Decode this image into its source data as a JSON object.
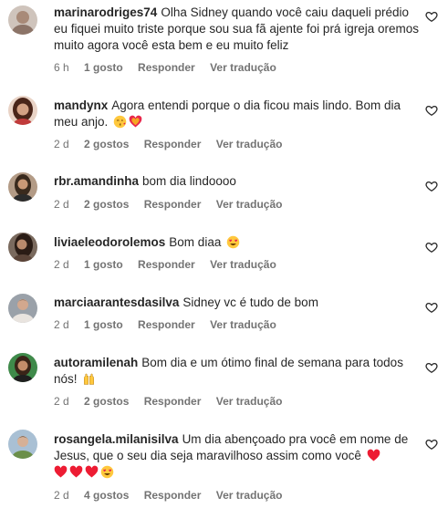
{
  "comments": [
    {
      "username": "marinarodriges74",
      "text": "Olha Sidney quando você caiu daqueli prédio eu fiquei muito triste porque sou sua fã ajente foi prá igreja oremos muito agora você esta bem e eu muito feliz",
      "time": "6 h",
      "likes": "1 gosto",
      "reply": "Responder",
      "translate": "Ver tradução",
      "avatar_color": "#b9a89e"
    },
    {
      "username": "mandynx",
      "text": "Agora entendi porque o dia ficou mais lindo. Bom dia meu anjo.",
      "emojis": [
        "kiss-emoji",
        "heart-emoji"
      ],
      "time": "2 d",
      "likes": "2 gostos",
      "reply": "Responder",
      "translate": "Ver tradução",
      "avatar_color": "#6b3a2a"
    },
    {
      "username": "rbr.amandinha",
      "text": "bom dia lindoooo",
      "time": "2 d",
      "likes": "2 gostos",
      "reply": "Responder",
      "translate": "Ver tradução",
      "avatar_color": "#4a3a2c"
    },
    {
      "username": "liviaeleodorolemos",
      "text": "Bom diaa",
      "emojis": [
        "heart-eyes-emoji"
      ],
      "time": "2 d",
      "likes": "1 gosto",
      "reply": "Responder",
      "translate": "Ver tradução",
      "avatar_color": "#3b2b24"
    },
    {
      "username": "marciaarantesdasilva",
      "text": "Sidney vc é tudo de bom",
      "time": "2 d",
      "likes": "1 gosto",
      "reply": "Responder",
      "translate": "Ver tradução",
      "avatar_color": "#8a8f96"
    },
    {
      "username": "autoramilenah",
      "text": "Bom dia e um ótimo final de semana para todos nós!",
      "emojis": [
        "raised-hands-emoji"
      ],
      "time": "2 d",
      "likes": "2 gostos",
      "reply": "Responder",
      "translate": "Ver tradução",
      "avatar_color": "#2f6e3a"
    },
    {
      "username": "rosangela.milanisilva",
      "text": "Um dia abençoado pra você em nome de Jesus, que o seu dia seja maravilhoso assim como você",
      "emojis": [
        "heart-emoji",
        "heart-emoji",
        "heart-emoji",
        "heart-emoji",
        "heart-eyes-emoji"
      ],
      "time": "2 d",
      "likes": "4 gostos",
      "reply": "Responder",
      "translate": "Ver tradução",
      "avatar_color": "#7e9a6a"
    }
  ],
  "colors": {
    "text": "#262626",
    "muted": "#737373",
    "heart_red": "#ed1c33"
  }
}
